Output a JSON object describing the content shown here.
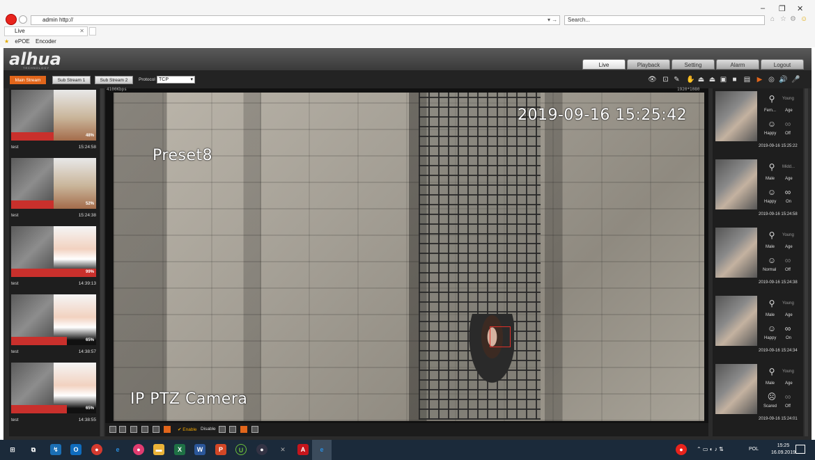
{
  "browser": {
    "address": "admin http://",
    "search_placeholder": "Search...",
    "tab_label": "Live",
    "favorites": [
      "ePOE",
      "Encoder"
    ],
    "window_controls": [
      "–",
      "❐",
      "✕"
    ]
  },
  "app": {
    "logo": "alhua",
    "logo_sub": "TECHNOLOGY",
    "nav": [
      "Live",
      "Playback",
      "Setting",
      "Alarm",
      "Logout"
    ],
    "active_nav": "Live",
    "streams": [
      "Main Stream",
      "Sub Stream 1",
      "Sub Stream 2"
    ],
    "protocol_label": "Protocol",
    "protocol_value": "TCP"
  },
  "video": {
    "bitrate": "4100Kbps",
    "resolution": "1920*1080",
    "osd_time": "2019-09-16 15:25:42",
    "osd_preset": "Preset8",
    "osd_title": "IP PTZ Camera",
    "enable_label": "Enable",
    "disable_label": "Disable"
  },
  "left_matches": [
    {
      "name": "test",
      "time": "15:24:58",
      "pct": "48%",
      "face": "woman"
    },
    {
      "name": "test",
      "time": "15:24:38",
      "pct": "52%",
      "face": "woman"
    },
    {
      "name": "test",
      "time": "14:39:13",
      "pct": "99%",
      "face": "man"
    },
    {
      "name": "test",
      "time": "14:38:57",
      "pct": "65%",
      "face": "man"
    },
    {
      "name": "test",
      "time": "14:38:55",
      "pct": "65%",
      "face": "man"
    }
  ],
  "right_faces": [
    {
      "age": "Young",
      "gender": "Fem...",
      "age_label": "Age",
      "expression": "Happy",
      "glasses": "Off",
      "time": "2019-09-16 15:25:22"
    },
    {
      "age": "Midd...",
      "gender": "Male",
      "age_label": "Age",
      "expression": "Happy",
      "glasses": "On",
      "time": "2019-09-16 15:24:58"
    },
    {
      "age": "Young",
      "gender": "Male",
      "age_label": "Age",
      "expression": "Normal",
      "glasses": "Off",
      "time": "2019-09-16 15:24:38"
    },
    {
      "age": "Young",
      "gender": "Male",
      "age_label": "Age",
      "expression": "Happy",
      "glasses": "On",
      "time": "2019-09-16 15:24:34"
    },
    {
      "age": "Young",
      "gender": "Male",
      "age_label": "Age",
      "expression": "Scared",
      "glasses": "Off",
      "time": "2019-09-16 15:24:01"
    }
  ],
  "taskbar": {
    "lang": "POL",
    "time": "15:25",
    "date": "16.09.2019"
  },
  "colors": {
    "accent": "#e2661b",
    "match_bar": "#c9302c",
    "face_box": "#e0302a"
  }
}
